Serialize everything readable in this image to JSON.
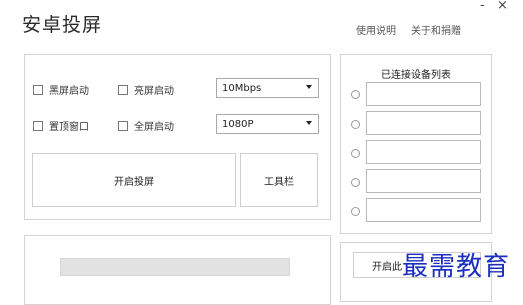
{
  "app": {
    "title": "安卓投屏"
  },
  "header": {
    "help_link": "使用说明",
    "about_link": "关于和捐赠"
  },
  "window_controls": {
    "minimize": "-",
    "close": "×"
  },
  "options": {
    "black_screen_start": "黑屏启动",
    "bright_screen_start": "亮屏启动",
    "always_on_top": "置顶窗口",
    "fullscreen_start": "全屏启动"
  },
  "bitrate_select": {
    "value": "10Mbps"
  },
  "resolution_select": {
    "value": "1080P"
  },
  "buttons": {
    "start_mirror": "开启投屏",
    "toolbar": "工具栏",
    "bottom_start": "开启此"
  },
  "devices": {
    "heading": "已连接设备列表",
    "slots": [
      "",
      "",
      "",
      "",
      ""
    ]
  },
  "watermark": "最需教育",
  "colors": {
    "watermark": "#1a2fbf",
    "border": "#d4d4d4",
    "progress": "#e2e2e2"
  }
}
